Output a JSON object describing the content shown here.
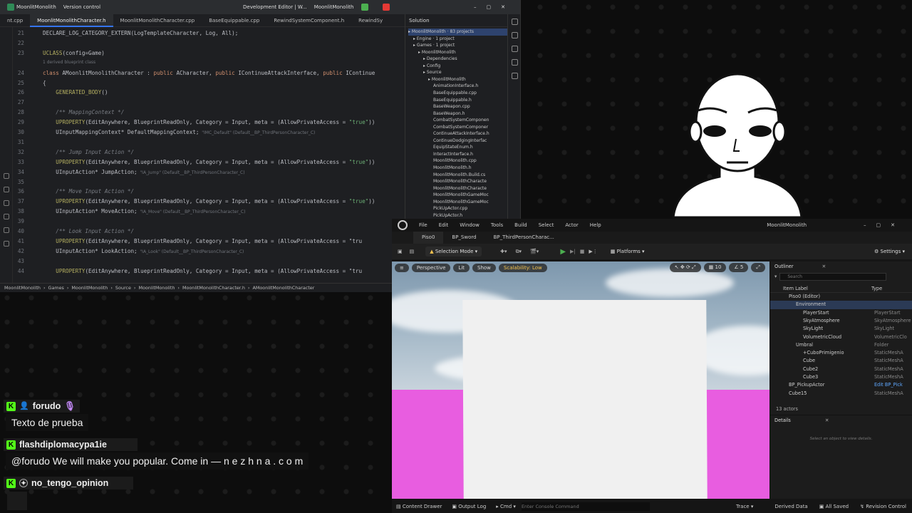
{
  "ide": {
    "title_items": [
      "MoonlitMonolith",
      "Version control",
      "Development Editor | W...",
      "MoonlitMonolith"
    ],
    "tabs": [
      "nt.cpp",
      "MoonlitMonolithCharacter.h",
      "MoonlitMonolithCharacter.cpp",
      "BaseEquippable.cpp",
      "RewindSystemComponent.h",
      "RewindSy"
    ],
    "active_tab": 1,
    "code": [
      {
        "n": "21",
        "t": "DECLARE_LOG_CATEGORY_EXTERN(LogTemplateCharacter, Log, All);"
      },
      {
        "n": "22",
        "t": ""
      },
      {
        "n": "23",
        "t": "UCLASS(config=Game)"
      },
      {
        "n": "",
        "t": "1 derived blueprint class",
        "hint": true
      },
      {
        "n": "24",
        "t": "class AMoonlitMonolithCharacter : public ACharacter, public IContinueAttackInterface, public IContinue"
      },
      {
        "n": "25",
        "t": "{"
      },
      {
        "n": "26",
        "t": "    GENERATED_BODY()"
      },
      {
        "n": "27",
        "t": ""
      },
      {
        "n": "28",
        "t": "    /** MappingContext */",
        "cm": true
      },
      {
        "n": "29",
        "t": "    UPROPERTY(EditAnywhere, BlueprintReadOnly, Category = Input, meta = (AllowPrivateAccess = \"true\"))"
      },
      {
        "n": "30",
        "t": "    UInputMappingContext* DefaultMappingContext;",
        "h": "\"IMC_Default\" (Default__BP_ThirdPersonCharacter_C)"
      },
      {
        "n": "31",
        "t": ""
      },
      {
        "n": "32",
        "t": "    /** Jump Input Action */",
        "cm": true
      },
      {
        "n": "33",
        "t": "    UPROPERTY(EditAnywhere, BlueprintReadOnly, Category = Input, meta = (AllowPrivateAccess = \"true\"))"
      },
      {
        "n": "34",
        "t": "    UInputAction* JumpAction;",
        "h": "\"IA_Jump\" (Default__BP_ThirdPersonCharacter_C)"
      },
      {
        "n": "35",
        "t": ""
      },
      {
        "n": "36",
        "t": "    /** Move Input Action */",
        "cm": true
      },
      {
        "n": "37",
        "t": "    UPROPERTY(EditAnywhere, BlueprintReadOnly, Category = Input, meta = (AllowPrivateAccess = \"true\"))"
      },
      {
        "n": "38",
        "t": "    UInputAction* MoveAction;",
        "h": "\"IA_Move\" (Default__BP_ThirdPersonCharacter_C)"
      },
      {
        "n": "39",
        "t": ""
      },
      {
        "n": "40",
        "t": "    /** Look Input Action */",
        "cm": true
      },
      {
        "n": "41",
        "t": "    UPROPERTY(EditAnywhere, BlueprintReadOnly, Category = Input, meta = (AllowPrivateAccess = \"tru"
      },
      {
        "n": "42",
        "t": "    UInputAction* LookAction;",
        "h": "\"IA_Look\" (Default__BP_ThirdPersonCharacter_C)"
      },
      {
        "n": "43",
        "t": ""
      },
      {
        "n": "44",
        "t": "    UPROPERTY(EditAnywhere, BlueprintReadOnly, Category = Input, meta = (AllowPrivateAccess = \"tru"
      }
    ],
    "breadcrumb": [
      "MoonlitMonolith",
      "Games",
      "MoonlitMonolith",
      "Source",
      "MoonlitMonolith",
      "MoonlitMonolithCharacter.h",
      "AMoonlitMonolithCharacter"
    ],
    "solution": {
      "title": "Solution",
      "items": [
        {
          "label": "MoonlitMonolith · 83 projects",
          "indent": 0,
          "sel": true
        },
        {
          "label": "Engine · 1 project",
          "indent": 1
        },
        {
          "label": "Games · 1 project",
          "indent": 1
        },
        {
          "label": "MoonlitMonolith",
          "indent": 2
        },
        {
          "label": "Dependencies",
          "indent": 3
        },
        {
          "label": "Config",
          "indent": 3
        },
        {
          "label": "Source",
          "indent": 3
        },
        {
          "label": "MoonlitMonolith",
          "indent": 4
        },
        {
          "label": "AnimationInterface.h",
          "indent": 5
        },
        {
          "label": "BaseEquippable.cpp",
          "indent": 5
        },
        {
          "label": "BaseEquippable.h",
          "indent": 5
        },
        {
          "label": "BaseWeapon.cpp",
          "indent": 5
        },
        {
          "label": "BaseWeapon.h",
          "indent": 5
        },
        {
          "label": "CombatSystemComponen",
          "indent": 5
        },
        {
          "label": "CombatSystemComponer",
          "indent": 5
        },
        {
          "label": "ContinueAttackInterface.h",
          "indent": 5
        },
        {
          "label": "ContinueDodgingInterfac",
          "indent": 5
        },
        {
          "label": "EquipStateEnum.h",
          "indent": 5
        },
        {
          "label": "InteractInterface.h",
          "indent": 5
        },
        {
          "label": "MoonlitMonolith.cpp",
          "indent": 5
        },
        {
          "label": "MoonlitMonolith.h",
          "indent": 5
        },
        {
          "label": "MoonlitMonolith.Build.cs",
          "indent": 5
        },
        {
          "label": "MoonlitMonolithCharacte",
          "indent": 5
        },
        {
          "label": "MoonlitMonolithCharacte",
          "indent": 5
        },
        {
          "label": "MoonlitMonolithGameMoc",
          "indent": 5
        },
        {
          "label": "MoonlitMonolithGameMoc",
          "indent": 5
        },
        {
          "label": "PickUpActor.cpp",
          "indent": 5
        },
        {
          "label": "PickUpActor.h",
          "indent": 5
        }
      ]
    }
  },
  "ue": {
    "menu": [
      "File",
      "Edit",
      "Window",
      "Tools",
      "Build",
      "Select",
      "Actor",
      "Help"
    ],
    "project_name": "MoonlitMonolith",
    "tabs": [
      "Piso0",
      "BP_Sword",
      "BP_ThirdPersonCharac..."
    ],
    "toolbar": {
      "mode": "Selection Mode",
      "platforms": "Platforms",
      "settings": "Settings"
    },
    "viewport": {
      "perspective": "Perspective",
      "lit": "Lit",
      "show": "Show",
      "scalability": "Scalability: Low",
      "grid": "10",
      "rot": "5"
    },
    "outliner": {
      "title": "Outliner",
      "search_placeholder": "Search",
      "col_label": "Item Label",
      "col_type": "Type",
      "rows": [
        {
          "name": "Piso0 (Editor)",
          "type": "",
          "indent": 1
        },
        {
          "name": "Environment",
          "type": "",
          "indent": 2,
          "sel": true
        },
        {
          "name": "PlayerStart",
          "type": "PlayerStart",
          "indent": 3
        },
        {
          "name": "SkyAtmosphere",
          "type": "SkyAtmosphere",
          "indent": 3
        },
        {
          "name": "SkyLight",
          "type": "SkyLight",
          "indent": 3
        },
        {
          "name": "VolumetricCloud",
          "type": "VolumetricClo",
          "indent": 3
        },
        {
          "name": "Umbral",
          "type": "Folder",
          "indent": 2
        },
        {
          "name": "+CuboPrimigenio",
          "type": "StaticMeshA",
          "indent": 3
        },
        {
          "name": "Cube",
          "type": "StaticMeshA",
          "indent": 3
        },
        {
          "name": "Cube2",
          "type": "StaticMeshA",
          "indent": 3
        },
        {
          "name": "Cube3",
          "type": "StaticMeshA",
          "indent": 3
        },
        {
          "name": "BP_PickupActor",
          "type": "Edit BP_Pick",
          "indent": 1,
          "link": true
        },
        {
          "name": "Cube15",
          "type": "StaticMeshA",
          "indent": 1
        }
      ],
      "count": "13 actors"
    },
    "details": {
      "title": "Details",
      "empty": "Select an object to view details."
    },
    "status": {
      "content_drawer": "Content Drawer",
      "output_log": "Output Log",
      "cmd": "Cmd",
      "console_placeholder": "Enter Console Command",
      "trace": "Trace",
      "derived": "Derived Data",
      "saved": "All Saved",
      "revision": "Revision Control"
    }
  },
  "chat": [
    {
      "user": "forudo",
      "message": "Texto de prueba"
    },
    {
      "user": "flashdiplomacypa1ie",
      "message": "@forudo We will make you popular. Come in — n e z h n a . c o m"
    },
    {
      "user": "no_tengo_opinion",
      "message": ""
    }
  ],
  "colors": {
    "kick_green": "#53fc18",
    "ue_accent": "#f3c350",
    "ground_pink": "#e85de0"
  }
}
